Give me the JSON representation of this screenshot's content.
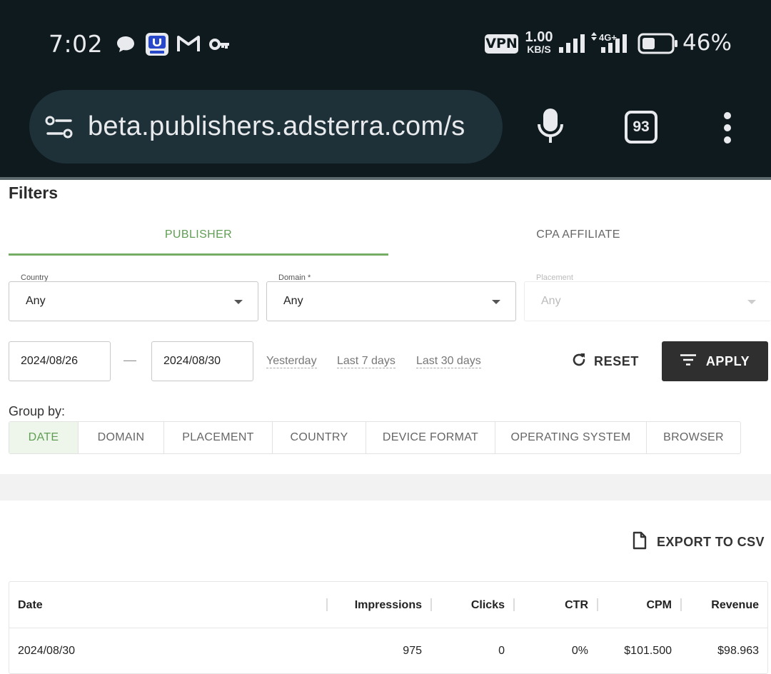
{
  "status_bar": {
    "time": "7:02",
    "notification_icons": [
      "chat-bubble-icon",
      "app-badge-icon",
      "gmail-icon",
      "key-icon"
    ],
    "vpn": "VPN",
    "speed_value": "1.00",
    "speed_unit": "KB/S",
    "network": "4G+",
    "battery_percent": "46%",
    "battery_level": 0.46
  },
  "browser": {
    "url": "beta.publishers.adsterra.com/s",
    "tab_count": "93"
  },
  "filters": {
    "title": "Filters",
    "tabs": [
      {
        "label": "PUBLISHER",
        "active": true
      },
      {
        "label": "CPA AFFILIATE",
        "active": false
      }
    ],
    "country": {
      "label": "Country",
      "value": "Any"
    },
    "domain": {
      "label": "Domain *",
      "value": "Any"
    },
    "placement": {
      "label": "Placement",
      "value": "Any",
      "disabled": true
    },
    "date_from": "2024/08/26",
    "date_separator": "—",
    "date_to": "2024/08/30",
    "quick_ranges": [
      "Yesterday",
      "Last 7 days",
      "Last 30 days"
    ],
    "reset_label": "RESET",
    "apply_label": "APPLY"
  },
  "group_by": {
    "label": "Group by:",
    "options": [
      {
        "label": "DATE",
        "active": true
      },
      {
        "label": "DOMAIN",
        "active": false
      },
      {
        "label": "PLACEMENT",
        "active": false
      },
      {
        "label": "COUNTRY",
        "active": false
      },
      {
        "label": "DEVICE FORMAT",
        "active": false
      },
      {
        "label": "OPERATING SYSTEM",
        "active": false
      },
      {
        "label": "BROWSER",
        "active": false
      }
    ]
  },
  "export_label": "EXPORT TO CSV",
  "table": {
    "headers": [
      "Date",
      "Impressions",
      "Clicks",
      "CTR",
      "CPM",
      "Revenue"
    ],
    "rows": [
      [
        "2024/08/30",
        "975",
        "0",
        "0%",
        "$101.500",
        "$98.963"
      ]
    ]
  },
  "colors": {
    "accent_green": "#5f9e52",
    "dark_button": "#2f2f2f",
    "status_bar_bg": "#0f1a1e",
    "url_bar_bg": "#1e3138"
  }
}
